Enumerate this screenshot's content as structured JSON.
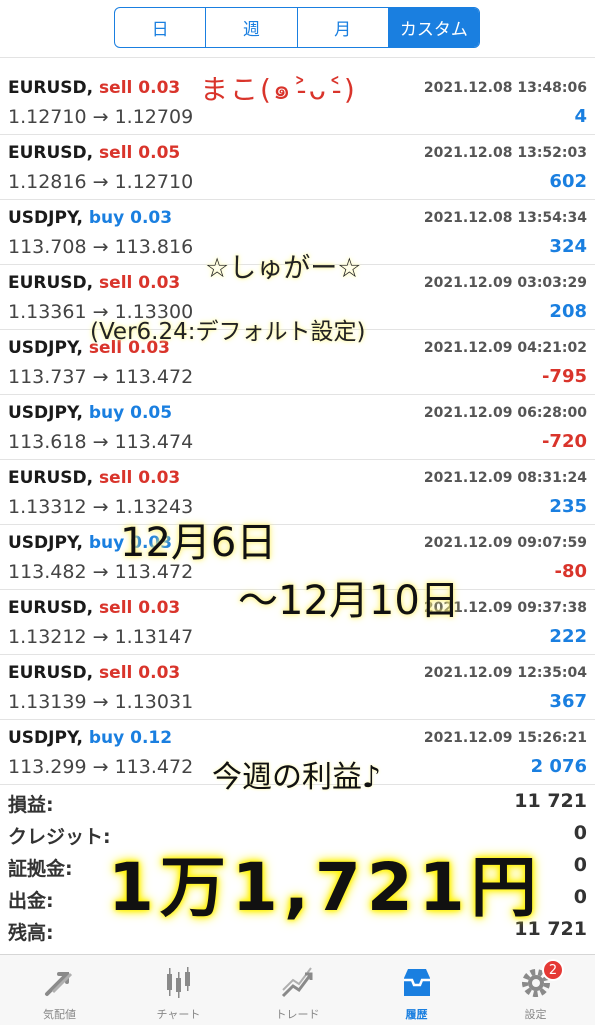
{
  "segments": [
    {
      "label": "日",
      "active": false
    },
    {
      "label": "週",
      "active": false
    },
    {
      "label": "月",
      "active": false
    },
    {
      "label": "カスタム",
      "active": true
    }
  ],
  "trades": [
    {
      "symbol": "EURUSD,",
      "side": "sell",
      "lots": "0.03",
      "time": "2021.12.08 13:48:06",
      "open": "1.12710",
      "close": "1.12709",
      "profit": "4",
      "profit_sign": "pos"
    },
    {
      "symbol": "EURUSD,",
      "side": "sell",
      "lots": "0.05",
      "time": "2021.12.08 13:52:03",
      "open": "1.12816",
      "close": "1.12710",
      "profit": "602",
      "profit_sign": "pos"
    },
    {
      "symbol": "USDJPY,",
      "side": "buy",
      "lots": "0.03",
      "time": "2021.12.08 13:54:34",
      "open": "113.708",
      "close": "113.816",
      "profit": "324",
      "profit_sign": "pos"
    },
    {
      "symbol": "EURUSD,",
      "side": "sell",
      "lots": "0.03",
      "time": "2021.12.09 03:03:29",
      "open": "1.13361",
      "close": "1.13300",
      "profit": "208",
      "profit_sign": "pos"
    },
    {
      "symbol": "USDJPY,",
      "side": "sell",
      "lots": "0.03",
      "time": "2021.12.09 04:21:02",
      "open": "113.737",
      "close": "113.472",
      "profit": "-795",
      "profit_sign": "neg"
    },
    {
      "symbol": "USDJPY,",
      "side": "buy",
      "lots": "0.05",
      "time": "2021.12.09 06:28:00",
      "open": "113.618",
      "close": "113.474",
      "profit": "-720",
      "profit_sign": "neg"
    },
    {
      "symbol": "EURUSD,",
      "side": "sell",
      "lots": "0.03",
      "time": "2021.12.09 08:31:24",
      "open": "1.13312",
      "close": "1.13243",
      "profit": "235",
      "profit_sign": "pos"
    },
    {
      "symbol": "USDJPY,",
      "side": "buy",
      "lots": "0.03",
      "time": "2021.12.09 09:07:59",
      "open": "113.482",
      "close": "113.472",
      "profit": "-80",
      "profit_sign": "neg"
    },
    {
      "symbol": "EURUSD,",
      "side": "sell",
      "lots": "0.03",
      "time": "2021.12.09 09:37:38",
      "open": "1.13212",
      "close": "1.13147",
      "profit": "222",
      "profit_sign": "pos"
    },
    {
      "symbol": "EURUSD,",
      "side": "sell",
      "lots": "0.03",
      "time": "2021.12.09 12:35:04",
      "open": "1.13139",
      "close": "1.13031",
      "profit": "367",
      "profit_sign": "pos"
    },
    {
      "symbol": "USDJPY,",
      "side": "buy",
      "lots": "0.12",
      "time": "2021.12.09 15:26:21",
      "open": "113.299",
      "close": "113.472",
      "profit": "2 076",
      "profit_sign": "pos"
    }
  ],
  "arrow": "→",
  "summary": [
    {
      "label": "損益:",
      "value": "11 721"
    },
    {
      "label": "クレジット:",
      "value": "0"
    },
    {
      "label": "証拠金:",
      "value": "0"
    },
    {
      "label": "出金:",
      "value": "0"
    },
    {
      "label": "残高:",
      "value": "11 721"
    }
  ],
  "overlays": {
    "maco": "まこ(๑˃̵ᴗ˂̵)",
    "sugar": "☆しゅがー☆",
    "version": "(Ver6.24:デフォルト設定)",
    "date_from": "12月6日",
    "date_to": "〜12月10日",
    "week_profit": "今週の利益♪",
    "big_total": "1万1,721円"
  },
  "tabs": [
    {
      "label": "気配値",
      "icon": "quotes-icon",
      "active": false
    },
    {
      "label": "チャート",
      "icon": "chart-icon",
      "active": false
    },
    {
      "label": "トレード",
      "icon": "trade-icon",
      "active": false
    },
    {
      "label": "履歴",
      "icon": "history-icon",
      "active": true
    },
    {
      "label": "設定",
      "icon": "gear-icon",
      "active": false,
      "badge": "2"
    }
  ],
  "colors": {
    "accent": "#1a7fe0",
    "sell": "#d9342b",
    "loss": "#d9342b",
    "highlight": "#fff200"
  }
}
